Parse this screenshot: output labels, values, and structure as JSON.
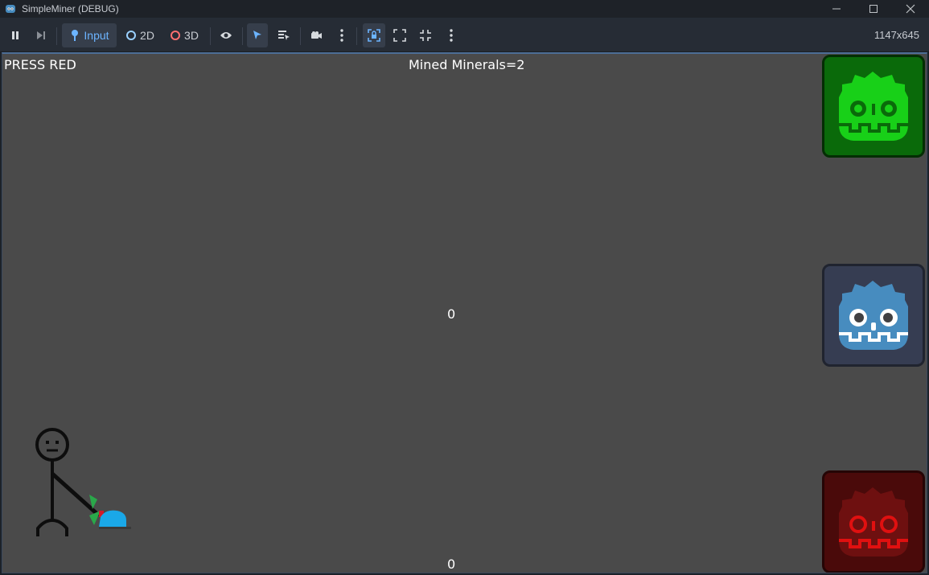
{
  "window": {
    "title": "SimpleMiner (DEBUG)",
    "controls": [
      "minimize-icon",
      "maximize-icon",
      "close-icon"
    ]
  },
  "toolbar": {
    "input_label": "Input",
    "mode_2d_label": "2D",
    "mode_3d_label": "3D",
    "resolution": "1147x645",
    "colors": {
      "accent": "#6cb4ff",
      "mode_2d_ring": "#9ad1ff",
      "mode_3d_ring": "#ff7070"
    }
  },
  "game": {
    "instruction": "PRESS RED",
    "mined_text": "Mined Minerals=2",
    "counter_mid": "0",
    "counter_bottom": "0",
    "robots": [
      {
        "name": "green",
        "color": "#0a6a0a",
        "face": "#18e018"
      },
      {
        "name": "blue",
        "color": "#363d52",
        "face": "#478cbf"
      },
      {
        "name": "red",
        "color": "#4a0a0a",
        "face": "#e01010"
      }
    ]
  }
}
